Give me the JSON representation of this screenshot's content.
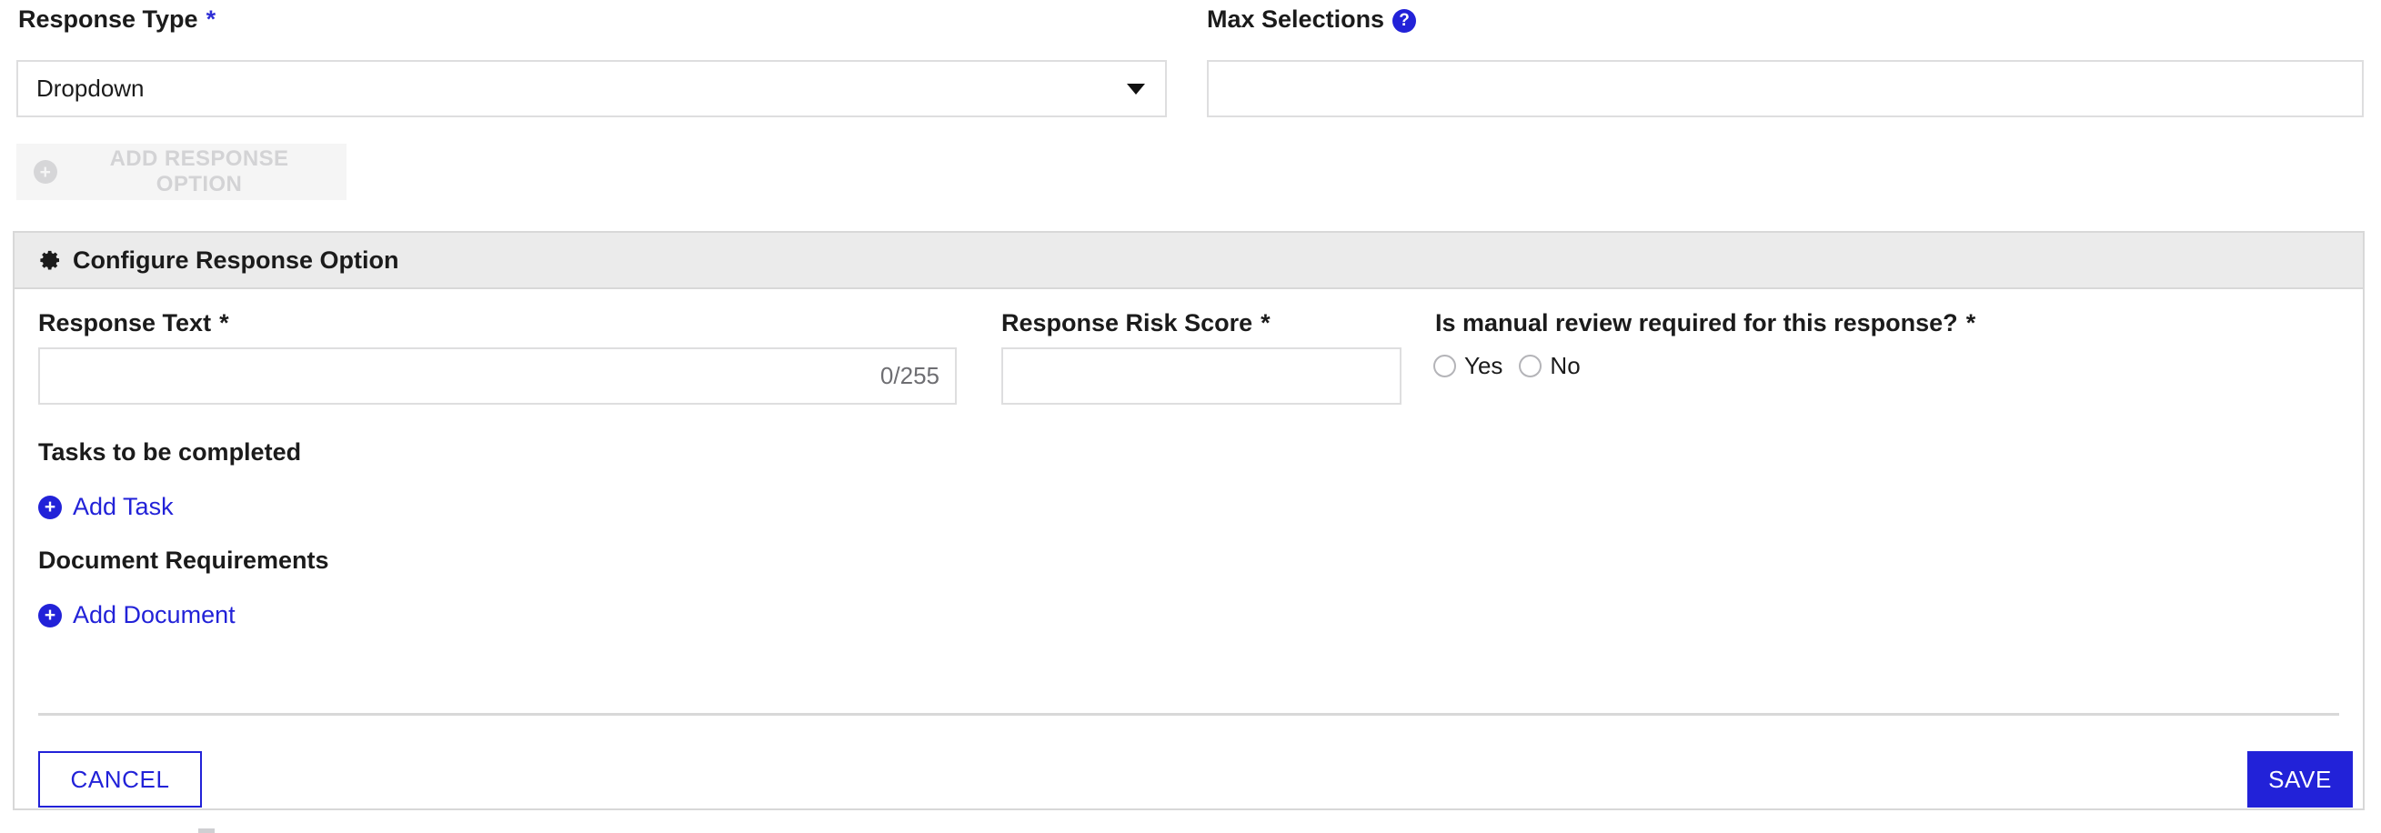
{
  "form": {
    "response_type": {
      "label": "Response Type",
      "required_marker": "*",
      "selected_value": "Dropdown",
      "caret_icon": "chevron-down-icon"
    },
    "max_selections": {
      "label": "Max Selections",
      "help_icon": "help-circle-icon",
      "help_glyph": "?",
      "value": "",
      "placeholder": ""
    },
    "add_response_option": {
      "label": "ADD RESPONSE OPTION",
      "icon": "plus-circle-icon",
      "icon_glyph": "+",
      "disabled": true
    }
  },
  "panel": {
    "header": {
      "title": "Configure Response Option",
      "icon": "gear-icon"
    },
    "response_text": {
      "label": "Response Text",
      "required_marker": "*",
      "value": "",
      "placeholder": "",
      "counter": "0/255",
      "max_length": 255
    },
    "risk_score": {
      "label": "Response Risk Score",
      "required_marker": "*",
      "value": "",
      "placeholder": ""
    },
    "manual_review": {
      "label": "Is manual review required for this response?",
      "required_marker": "*",
      "options": [
        {
          "label": "Yes",
          "selected": false
        },
        {
          "label": "No",
          "selected": false
        }
      ]
    },
    "tasks": {
      "heading": "Tasks to be completed",
      "add_label": "Add Task",
      "add_icon": "plus-circle-icon",
      "add_icon_glyph": "+"
    },
    "documents": {
      "heading": "Document Requirements",
      "add_label": "Add Document",
      "add_icon": "plus-circle-icon",
      "add_icon_glyph": "+"
    },
    "footer": {
      "cancel_label": "CANCEL",
      "save_label": "SAVE"
    }
  },
  "colors": {
    "accent_blue": "#2222d8",
    "panel_header_bg": "#ebebeb",
    "border_grey": "#d8d8d8",
    "input_border": "#dededf",
    "disabled_bg": "#f5f5f5",
    "disabled_text": "#d3d3d5",
    "counter_text": "#6e6e72",
    "text_dark": "#1b1b1b"
  }
}
